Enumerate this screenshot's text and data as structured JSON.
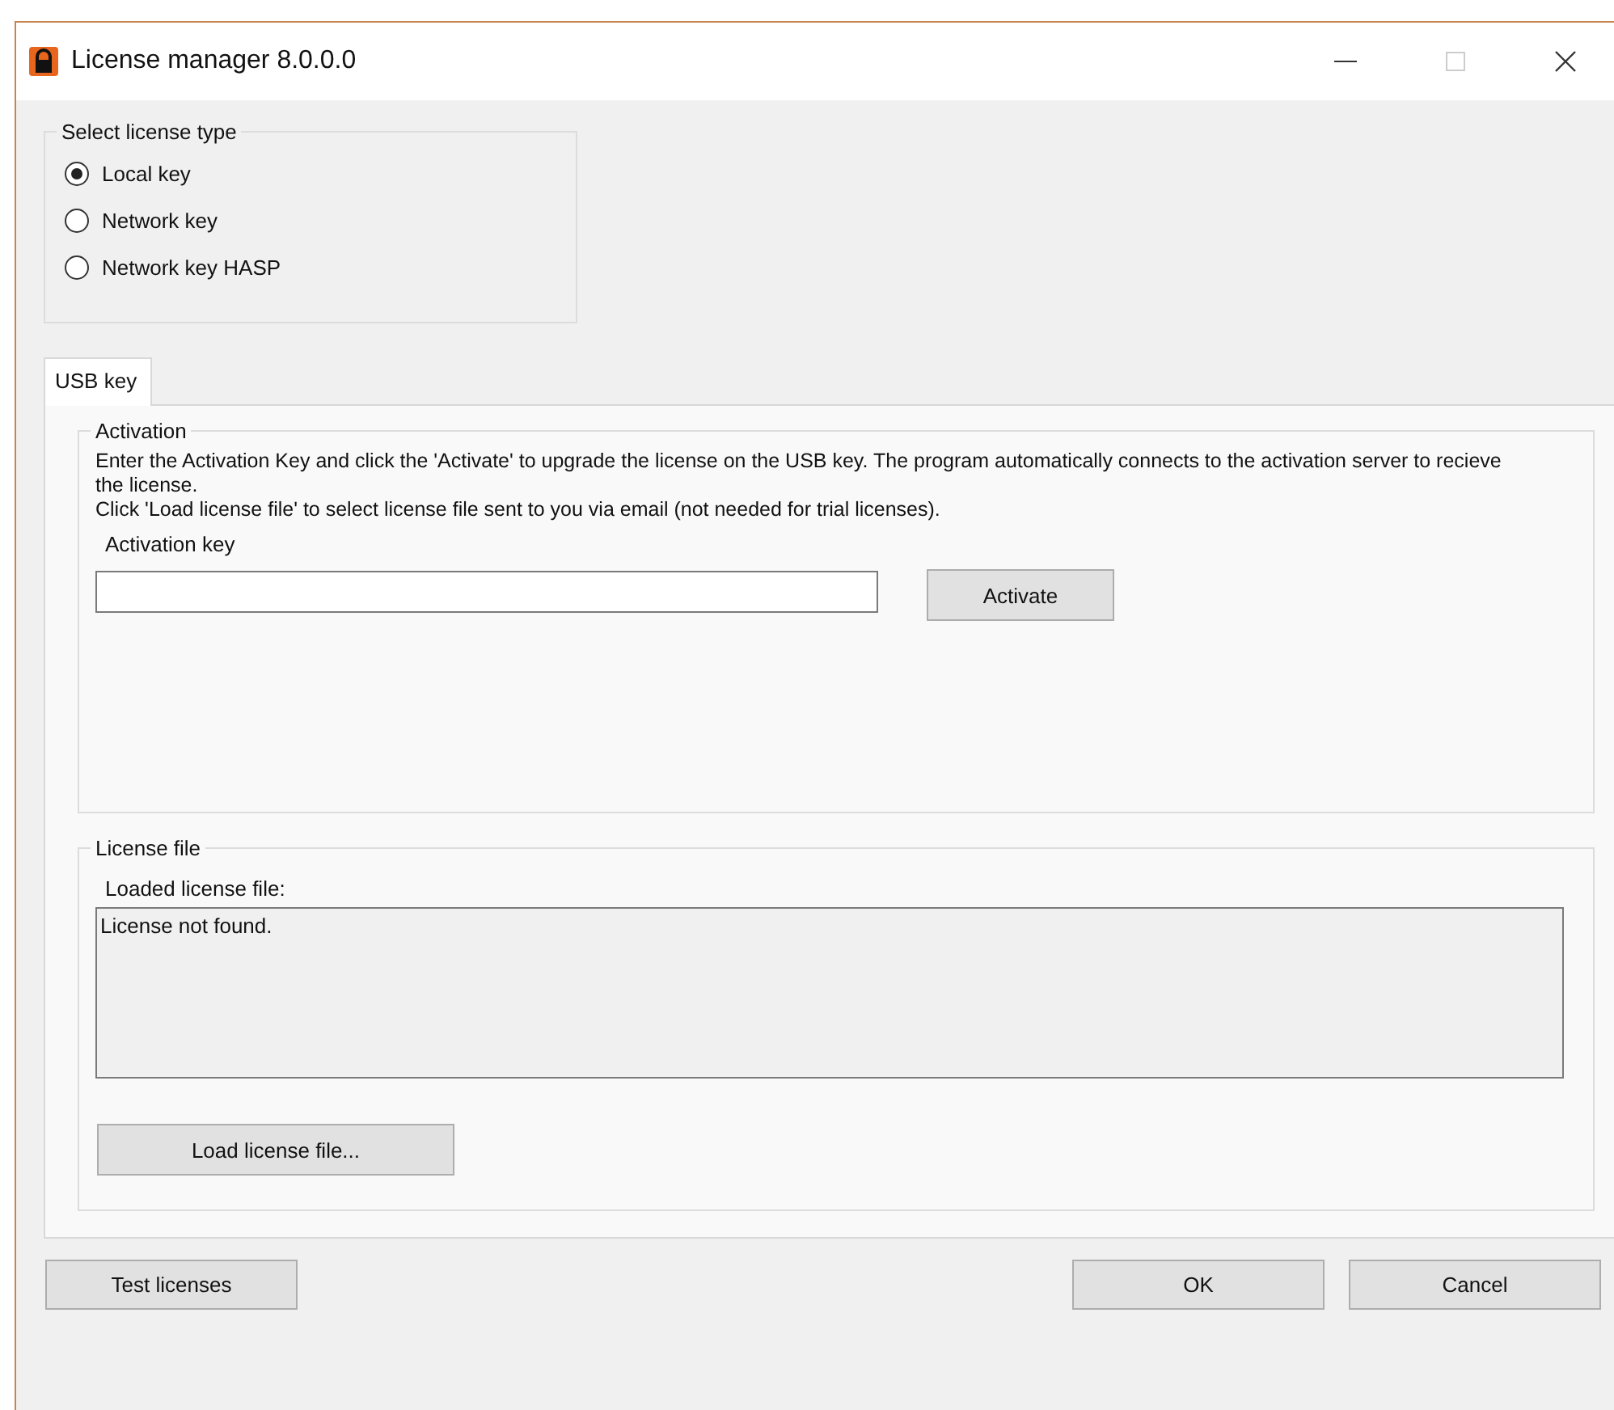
{
  "window": {
    "title": "License manager 8.0.0.0",
    "maximize_disabled": true
  },
  "license_type": {
    "title": "Select license type",
    "options": [
      {
        "label": "Local key",
        "selected": true
      },
      {
        "label": "Network key",
        "selected": false
      },
      {
        "label": "Network key HASP",
        "selected": false
      }
    ]
  },
  "tabs": [
    {
      "label": "USB key",
      "selected": true
    }
  ],
  "activation": {
    "title": "Activation",
    "description": [
      "Enter the Activation Key and click the 'Activate' to upgrade the license on the USB key. The program automatically connects to the activation server to recieve the license.",
      "Click 'Load license file' to select license file sent to you via email (not needed for trial licenses)."
    ],
    "key_label": "Activation key",
    "button": "Activate"
  },
  "license_file": {
    "title": "License file",
    "loaded_label": "Loaded license file:",
    "content": "License not found.",
    "button": "Load license file..."
  },
  "buttons": {
    "test": "Test licenses",
    "ok": "OK",
    "cancel": "Cancel"
  }
}
